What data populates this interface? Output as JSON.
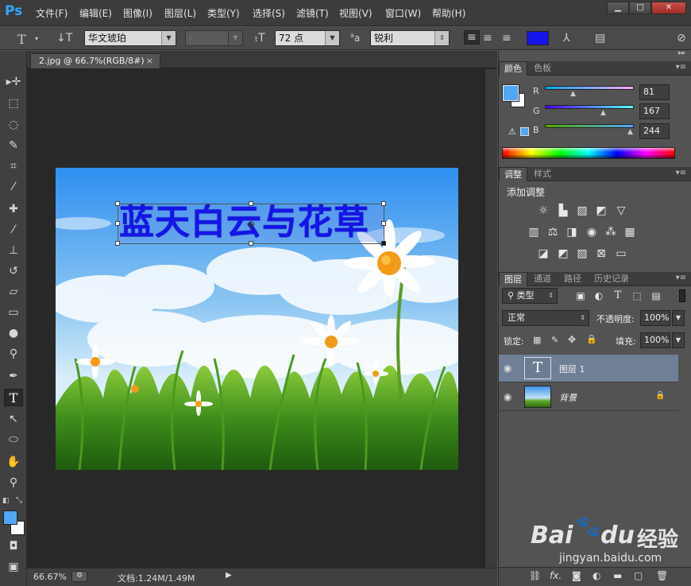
{
  "app": {
    "logo": "Ps"
  },
  "menu": [
    "文件(F)",
    "编辑(E)",
    "图像(I)",
    "图层(L)",
    "类型(Y)",
    "选择(S)",
    "滤镜(T)",
    "视图(V)",
    "窗口(W)",
    "帮助(H)"
  ],
  "window_controls": [
    "minimize-icon",
    "maximize-icon",
    "close-icon"
  ],
  "options": {
    "tool_icon": "type-tool-icon",
    "orientation_icon": "text-orientation-icon",
    "font_family": "华文琥珀",
    "font_style": "-",
    "font_size": "72 点",
    "aa_label": "a",
    "aa_sup": "a",
    "anti_alias": "锐利",
    "text_color": "#1515e6"
  },
  "document": {
    "tab_title": "2.jpg @ 66.7%(RGB/8#)",
    "close": "×",
    "text_layer_content": "蓝天白云与花草",
    "zoom": "66.67%",
    "doc_info": "文档:1.24M/1.49M"
  },
  "color_panel": {
    "tabs": [
      "颜色",
      "色板"
    ],
    "r_label": "R",
    "g_label": "G",
    "b_label": "B",
    "r": "81",
    "g": "167",
    "b": "244",
    "fg_color": "#51a7f4",
    "bg_color": "#ffffff"
  },
  "adjustments_panel": {
    "tabs": [
      "调整",
      "样式"
    ],
    "title": "添加调整",
    "row1": [
      "brightness-icon",
      "levels-icon",
      "curves-icon",
      "exposure-icon",
      "vibrance-icon"
    ],
    "row2": [
      "hue-saturation-icon",
      "color-balance-icon",
      "black-white-icon",
      "photo-filter-icon",
      "channel-mixer-icon",
      "color-lookup-icon"
    ],
    "row3": [
      "invert-icon",
      "posterize-icon",
      "threshold-icon",
      "selective-color-icon",
      "gradient-map-icon"
    ]
  },
  "layers_panel": {
    "tabs": [
      "图层",
      "通道",
      "路径",
      "历史记录"
    ],
    "filter_kind": "类型",
    "blend_mode": "正常",
    "opacity_label": "不透明度:",
    "opacity": "100%",
    "lock_label": "锁定:",
    "fill_label": "填充:",
    "fill": "100%",
    "layers": [
      {
        "name": "图层 1",
        "type": "text",
        "thumb_glyph": "T",
        "selected": true
      },
      {
        "name": "背景",
        "type": "image",
        "locked": true,
        "selected": false
      }
    ]
  },
  "watermark": {
    "brand": "Bai",
    "brand2": "du",
    "cn": "经验",
    "url": "jingyan.baidu.com"
  }
}
